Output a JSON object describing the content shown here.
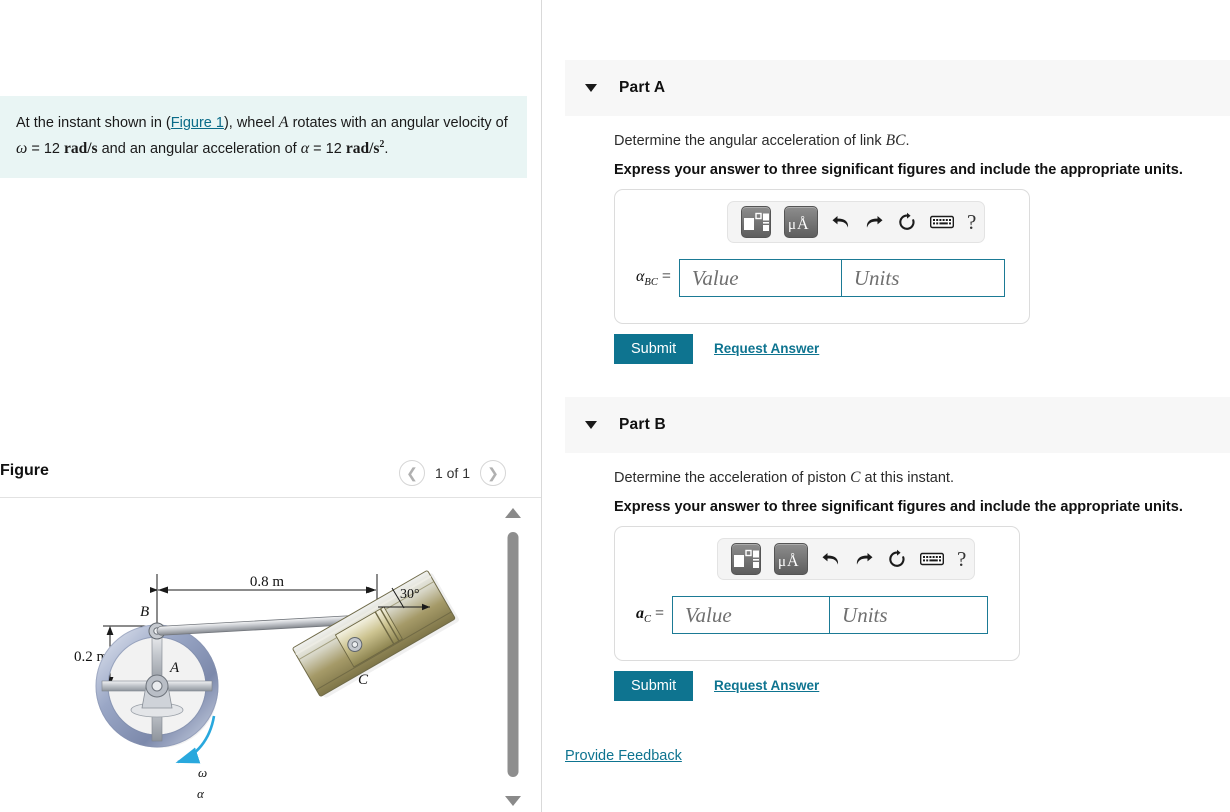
{
  "problem": {
    "text_before_link": "At the instant shown in (",
    "figure_link": "Figure 1",
    "text_after_link": "), wheel ",
    "wheel_symbol": "A",
    "text_mid": " rotates with an angular velocity of ",
    "omega_symbol": "ω",
    "omega_eq": " = 12 ",
    "omega_units": "rad/s",
    "text_mid2": " and an angular acceleration of ",
    "alpha_symbol": "α",
    "alpha_eq": " = 12 ",
    "alpha_units": "rad/s",
    "alpha_exp": "2",
    "period": "."
  },
  "figure": {
    "title": "Figure",
    "prev_icon": "chevron-left-icon",
    "next_icon": "chevron-right-icon",
    "counter": "1 of 1",
    "diagram": {
      "dimension_horizontal": "0.8 m",
      "dimension_vertical": "0.2 m",
      "angle": "30°",
      "label_a": "A",
      "label_b": "B",
      "label_c": "C",
      "label_omega": "ω",
      "label_alpha": "α",
      "wheel_color": "#9ba8c4",
      "rod_color": "#b9bcc0",
      "cylinder_color": "#b3a878",
      "arrow_color": "#29a8dd"
    },
    "scrollbar": {
      "up_icon": "triangle-up-icon",
      "down_icon": "triangle-down-icon"
    }
  },
  "parts": [
    {
      "id": "a",
      "caret_icon": "caret-down-icon",
      "label": "Part A",
      "question": "Determine the angular acceleration of link ",
      "question_var": "BC",
      "question_end": ".",
      "instruction": "Express your answer to three significant figures and include the appropriate units.",
      "symbol_main": "α",
      "symbol_sub": "BC",
      "symbol_eq": " =",
      "value_placeholder": "Value",
      "units_placeholder": "Units",
      "value_text": "",
      "units_text": "",
      "submit_label": "Submit",
      "request_label": "Request Answer",
      "toolbar": {
        "template_icon": "math-template-icon",
        "units_icon": "micro-angstrom-units-icon",
        "undo_icon": "undo-arrow-icon",
        "redo_icon": "redo-arrow-icon",
        "reset_icon": "reset-circular-arrow-icon",
        "keyboard_icon": "keyboard-icon",
        "help_icon": "question-mark-icon",
        "help_label": "?"
      }
    },
    {
      "id": "b",
      "caret_icon": "caret-down-icon",
      "label": "Part B",
      "question": "Determine the acceleration of piston ",
      "question_var": "C",
      "question_end": " at this instant.",
      "instruction": "Express your answer to three significant figures and include the appropriate units.",
      "symbol_main": "a",
      "symbol_sub": "C",
      "symbol_eq": " =",
      "value_placeholder": "Value",
      "units_placeholder": "Units",
      "value_text": "",
      "units_text": "",
      "submit_label": "Submit",
      "request_label": "Request Answer",
      "toolbar": {
        "template_icon": "math-template-icon",
        "units_icon": "micro-angstrom-units-icon",
        "undo_icon": "undo-arrow-icon",
        "redo_icon": "redo-arrow-icon",
        "reset_icon": "reset-circular-arrow-icon",
        "keyboard_icon": "keyboard-icon",
        "help_icon": "question-mark-icon",
        "help_label": "?"
      }
    }
  ],
  "footer": {
    "feedback_label": "Provide Feedback"
  },
  "colors": {
    "accent": "#0e7490",
    "problem_bg": "#e9f5f4",
    "header_bg": "#f7f7f7",
    "input_border": "#1b7a95"
  }
}
